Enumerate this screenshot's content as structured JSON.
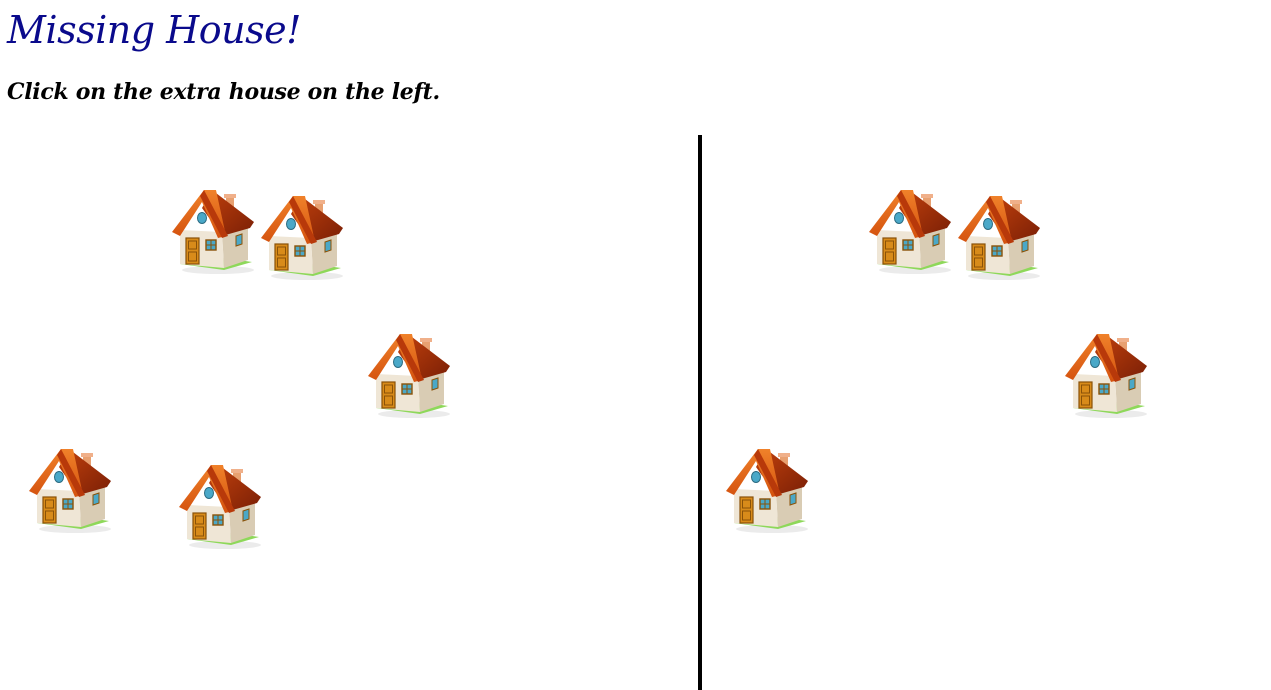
{
  "game": {
    "title": "Missing House!",
    "instruction": "Click on the extra house on the left."
  },
  "colors": {
    "title": "#0a0a8c",
    "divider": "#000000",
    "roof": "#d4520e",
    "wall": "#efe6d6",
    "door": "#d88b1a",
    "grass": "#8ed85a",
    "window": "#4aa8c8"
  },
  "icons": {
    "house": "house-icon"
  },
  "left_panel": {
    "house_count": 5,
    "houses": [
      "house",
      "house",
      "house",
      "house",
      "house"
    ]
  },
  "right_panel": {
    "house_count": 4,
    "houses": [
      "house",
      "house",
      "house",
      "house"
    ]
  }
}
